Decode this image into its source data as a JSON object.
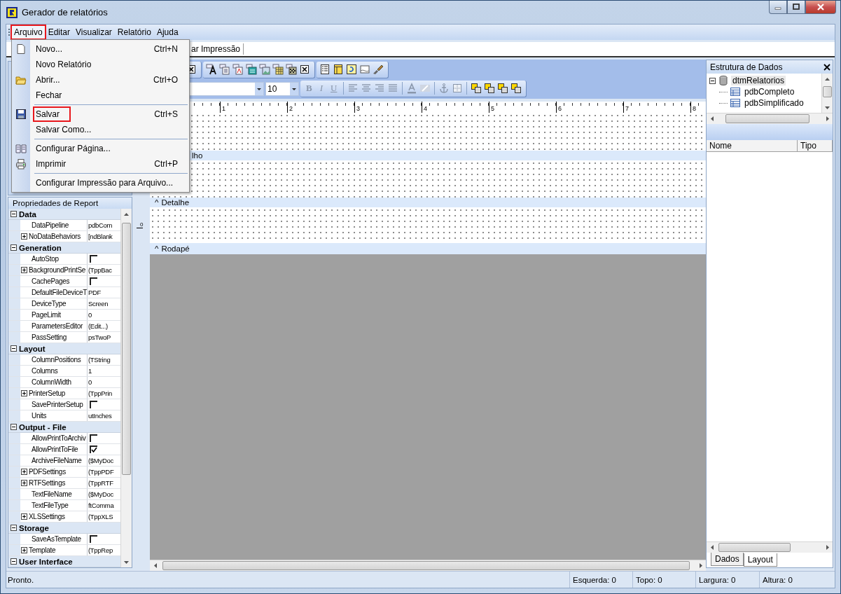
{
  "window": {
    "title": "Gerador de relatórios"
  },
  "menu_bar": [
    {
      "label": "Arquivo",
      "selected": true,
      "highlighted": true
    },
    {
      "label": "Editar",
      "selected": false,
      "highlighted": false
    },
    {
      "label": "Visualizar",
      "selected": false,
      "highlighted": false
    },
    {
      "label": "Relatório",
      "selected": false,
      "highlighted": false
    },
    {
      "label": "Ajuda",
      "selected": false,
      "highlighted": false
    }
  ],
  "file_menu": [
    {
      "kind": "item",
      "label": "Novo...",
      "shortcut": "Ctrl+N",
      "highlighted": false
    },
    {
      "kind": "item",
      "label": "Novo Relatório",
      "highlighted": false
    },
    {
      "kind": "item",
      "label": "Abrir...",
      "shortcut": "Ctrl+O",
      "highlighted": false
    },
    {
      "kind": "item",
      "label": "Fechar",
      "highlighted": false
    },
    {
      "kind": "separator"
    },
    {
      "kind": "item",
      "label": "Salvar",
      "shortcut": "Ctrl+S",
      "highlighted": true
    },
    {
      "kind": "item",
      "label": "Salvar Como...",
      "highlighted": false
    },
    {
      "kind": "separator"
    },
    {
      "kind": "item",
      "label": "Configurar Página...",
      "highlighted": false
    },
    {
      "kind": "item",
      "label": "Imprimir",
      "shortcut": "Ctrl+P",
      "highlighted": false
    },
    {
      "kind": "separator"
    },
    {
      "kind": "item",
      "label": "Configurar Impressão para Arquivo...",
      "highlighted": false
    }
  ],
  "design_tabs": [
    {
      "label": "ar Impressão"
    }
  ],
  "format_toolbar": {
    "font_size": "10",
    "style_buttons": [
      "B",
      "I",
      "U"
    ]
  },
  "ruler": {
    "marks": [
      "1",
      "2",
      "3",
      "4",
      "5",
      "6",
      "7",
      "8"
    ]
  },
  "bands": [
    {
      "label": "lho"
    },
    {
      "caret": "^",
      "label": "Detalhe"
    },
    {
      "caret": "^",
      "label": "Rodapé",
      "ruler_label": "0"
    }
  ],
  "properties": {
    "title": "Propriedades de Report",
    "categories": [
      {
        "name": "Data",
        "expanded": true,
        "rows": [
          {
            "kind": "text",
            "name": "DataPipeline",
            "value": "pdbCom",
            "expandable": false
          },
          {
            "kind": "text",
            "name": "NoDataBehaviors",
            "value": "[ndBlank",
            "expandable": true
          }
        ]
      },
      {
        "name": "Generation",
        "expanded": true,
        "rows": [
          {
            "kind": "check",
            "name": "AutoStop",
            "checked": false,
            "expandable": false
          },
          {
            "kind": "text",
            "name": "BackgroundPrintSe",
            "value": "(TppBac",
            "expandable": true
          },
          {
            "kind": "check",
            "name": "CachePages",
            "checked": false,
            "expandable": false
          },
          {
            "kind": "text",
            "name": "DefaultFileDeviceT",
            "value": "PDF",
            "expandable": false
          },
          {
            "kind": "text",
            "name": "DeviceType",
            "value": "Screen",
            "expandable": false
          },
          {
            "kind": "text",
            "name": "PageLimit",
            "value": "0",
            "expandable": false
          },
          {
            "kind": "text",
            "name": "ParametersEditor",
            "value": "(Edit...)",
            "expandable": false
          },
          {
            "kind": "text",
            "name": "PassSetting",
            "value": "psTwoP",
            "expandable": false
          }
        ]
      },
      {
        "name": "Layout",
        "expanded": true,
        "rows": [
          {
            "kind": "text",
            "name": "ColumnPositions",
            "value": "(TString",
            "expandable": false
          },
          {
            "kind": "text",
            "name": "Columns",
            "value": "1",
            "expandable": false
          },
          {
            "kind": "text",
            "name": "ColumnWidth",
            "value": "0",
            "expandable": false
          },
          {
            "kind": "text",
            "name": "PrinterSetup",
            "value": "(TppPrin",
            "expandable": true
          },
          {
            "kind": "check",
            "name": "SavePrinterSetup",
            "checked": false,
            "expandable": false
          },
          {
            "kind": "text",
            "name": "Units",
            "value": "utInches",
            "expandable": false
          }
        ]
      },
      {
        "name": "Output - File",
        "expanded": true,
        "rows": [
          {
            "kind": "check",
            "name": "AllowPrintToArchiv",
            "checked": false,
            "expandable": false
          },
          {
            "kind": "check",
            "name": "AllowPrintToFile",
            "checked": true,
            "expandable": false
          },
          {
            "kind": "text",
            "name": "ArchiveFileName",
            "value": "($MyDoc",
            "expandable": false
          },
          {
            "kind": "text",
            "name": "PDFSettings",
            "value": "(TppPDF",
            "expandable": true
          },
          {
            "kind": "text",
            "name": "RTFSettings",
            "value": "(TppRTF",
            "expandable": true
          },
          {
            "kind": "text",
            "name": "TextFileName",
            "value": "($MyDoc",
            "expandable": false
          },
          {
            "kind": "text",
            "name": "TextFileType",
            "value": "ftComma",
            "expandable": false
          },
          {
            "kind": "text",
            "name": "XLSSettings",
            "value": "(TppXLS",
            "expandable": true
          }
        ]
      },
      {
        "name": "Storage",
        "expanded": true,
        "rows": [
          {
            "kind": "check",
            "name": "SaveAsTemplate",
            "checked": false,
            "expandable": false
          },
          {
            "kind": "text",
            "name": "Template",
            "value": "(TppRep",
            "expandable": true
          }
        ]
      },
      {
        "name": "User Interface",
        "expanded": true
      }
    ]
  },
  "data_panel": {
    "title": "Estrutura de Dados",
    "tree": [
      {
        "label": "dtmRelatorios",
        "expanded": true,
        "selected": true,
        "children": [
          {
            "label": "pdbCompleto",
            "selected": false
          },
          {
            "label": "pdbSimplificado",
            "selected": false
          }
        ]
      }
    ],
    "columns": [
      "Nome",
      "Tipo"
    ],
    "tabs": [
      {
        "label": "Dados",
        "selected": true
      },
      {
        "label": "Layout",
        "selected": false
      }
    ]
  },
  "status_bar": [
    "Pronto.",
    "Esquerda: 0",
    "Topo: 0",
    "Largura: 0",
    "Altura: 0"
  ]
}
